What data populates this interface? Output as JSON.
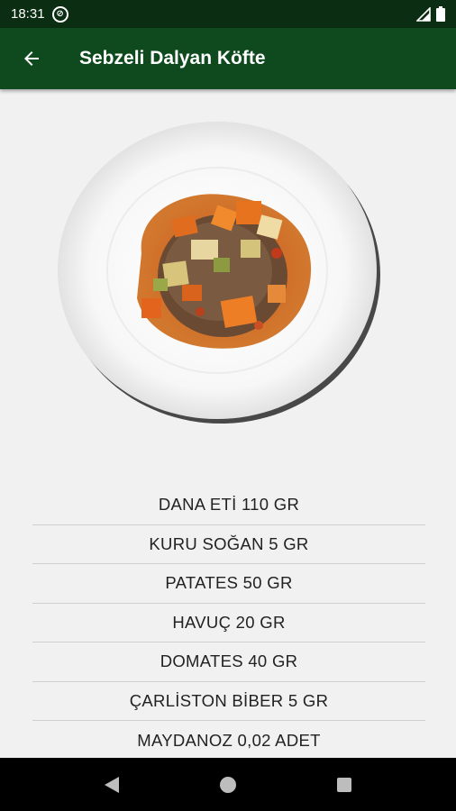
{
  "status": {
    "time": "18:31"
  },
  "header": {
    "title": "Sebzeli Dalyan Köfte"
  },
  "dish_image": {
    "description_icon": "plated-dish-image"
  },
  "ingredients": [
    "DANA ETİ 110 GR",
    "KURU SOĞAN 5 GR",
    "PATATES 50 GR",
    "HAVUÇ 20 GR",
    "DOMATES 40 GR",
    "ÇARLİSTON BİBER 5 GR",
    "MAYDANOZ 0,02 ADET"
  ],
  "colors": {
    "status_bar": "#0b2e13",
    "app_bar": "#0f4a1e",
    "background": "#f1f1f1"
  }
}
